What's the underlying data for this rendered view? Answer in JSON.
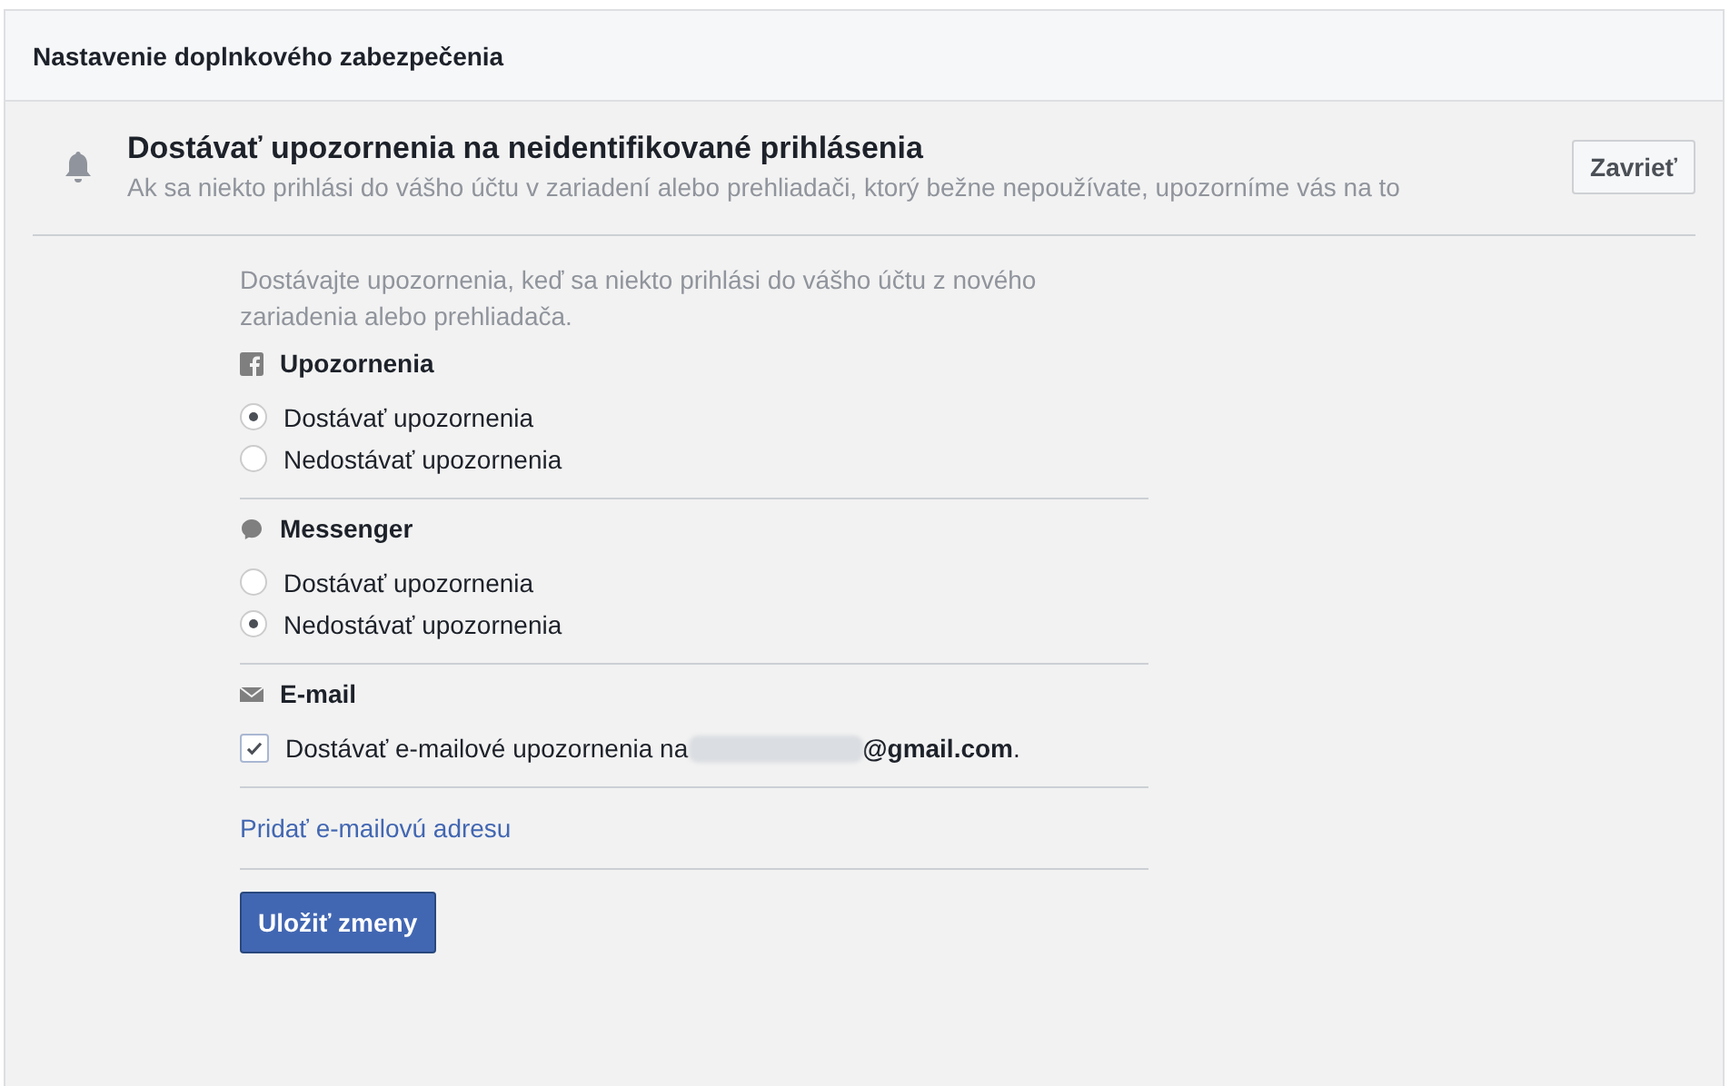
{
  "panel": {
    "title": "Nastavenie doplnkového zabezpečenia"
  },
  "banner": {
    "title": "Dostávať upozornenia na neidentifikované prihlásenia",
    "subtitle": "Ak sa niekto prihlási do vášho účtu v zariadení alebo prehliadači, ktorý bežne nepoužívate, upozorníme vás na to",
    "close_button": "Zavrieť"
  },
  "intro": "Dostávajte upozornenia, keď sa niekto prihlási do vášho účtu z nového zariadenia alebo prehliadača.",
  "sections": [
    {
      "title": "Upozornenia",
      "kind": "radio",
      "options": [
        {
          "label": "Dostávať upozornenia",
          "selected": true
        },
        {
          "label": "Nedostávať upozornenia",
          "selected": false
        }
      ]
    },
    {
      "title": "Messenger",
      "kind": "radio",
      "options": [
        {
          "label": "Dostávať upozornenia",
          "selected": false
        },
        {
          "label": "Nedostávať upozornenia",
          "selected": true
        }
      ]
    },
    {
      "title": "E-mail",
      "kind": "checkbox",
      "options": [
        {
          "label": "Dostávať e-mailové upozornenia na",
          "address": "**@gmail.com**.",
          "checked": true
        }
      ]
    }
  ],
  "add_link": "Pridať e-mailovú adresu",
  "save_button": "Uložiť zmeny"
}
